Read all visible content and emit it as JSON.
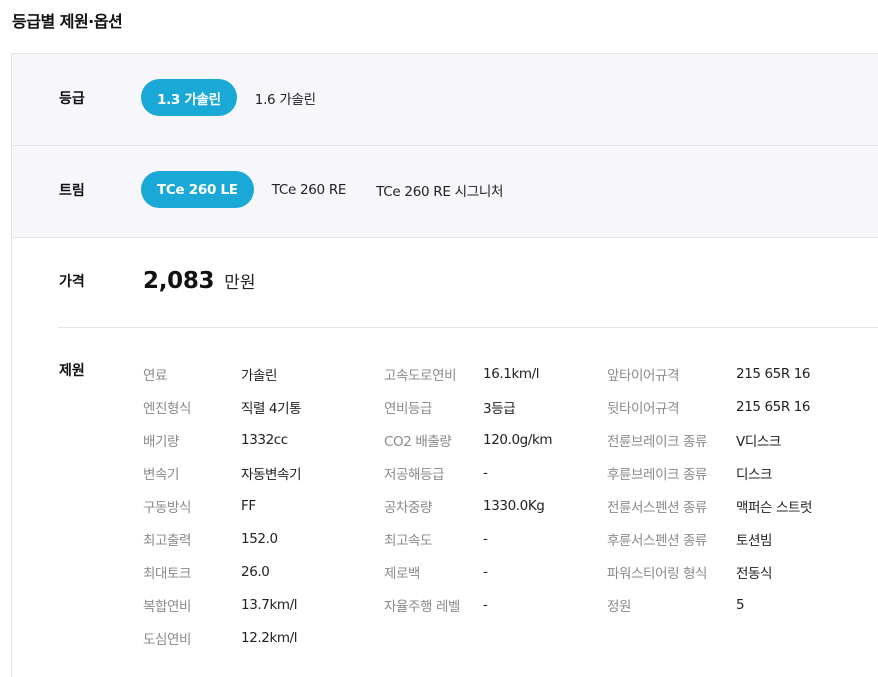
{
  "page_title": "등급별 제원·옵션",
  "grade": {
    "label": "등급",
    "options": [
      "1.3 가솔린",
      "1.6 가솔린"
    ],
    "selected": "1.3 가솔린"
  },
  "trim": {
    "label": "트림",
    "options": [
      "TCe 260 LE",
      "TCe 260 RE",
      "TCe 260 RE 시그니처"
    ],
    "selected": "TCe 260 LE"
  },
  "price": {
    "label": "가격",
    "value": "2,083",
    "unit": "만원"
  },
  "specs": {
    "label": "제원",
    "columns": [
      [
        {
          "key": "연료",
          "value": "가솔린"
        },
        {
          "key": "엔진형식",
          "value": "직렬 4기통"
        },
        {
          "key": "배기량",
          "value": "1332cc"
        },
        {
          "key": "변속기",
          "value": "자동변속기"
        },
        {
          "key": "구동방식",
          "value": "FF"
        },
        {
          "key": "최고출력",
          "value": "152.0"
        },
        {
          "key": "최대토크",
          "value": "26.0"
        },
        {
          "key": "복합연비",
          "value": "13.7km/l"
        },
        {
          "key": "도심연비",
          "value": "12.2km/l"
        }
      ],
      [
        {
          "key": "고속도로연비",
          "value": "16.1km/l"
        },
        {
          "key": "연비등급",
          "value": "3등급"
        },
        {
          "key": "CO2 배출량",
          "value": "120.0g/km"
        },
        {
          "key": "저공해등급",
          "value": "-"
        },
        {
          "key": "공차중량",
          "value": "1330.0Kg"
        },
        {
          "key": "최고속도",
          "value": "-"
        },
        {
          "key": "제로백",
          "value": "-"
        },
        {
          "key": "자율주행 레벨",
          "value": "-"
        }
      ],
      [
        {
          "key": "앞타이어규격",
          "value": "215 65R 16"
        },
        {
          "key": "뒷타이어규격",
          "value": "215 65R 16"
        },
        {
          "key": "전륜브레이크 종류",
          "value": "V디스크"
        },
        {
          "key": "후륜브레이크 종류",
          "value": "디스크"
        },
        {
          "key": "전륜서스펜션 종류",
          "value": "맥퍼슨 스트럿"
        },
        {
          "key": "후륜서스펜션 종류",
          "value": "토션빔"
        },
        {
          "key": "파워스티어링 형식",
          "value": "전동식"
        },
        {
          "key": "정원",
          "value": "5"
        }
      ]
    ]
  }
}
